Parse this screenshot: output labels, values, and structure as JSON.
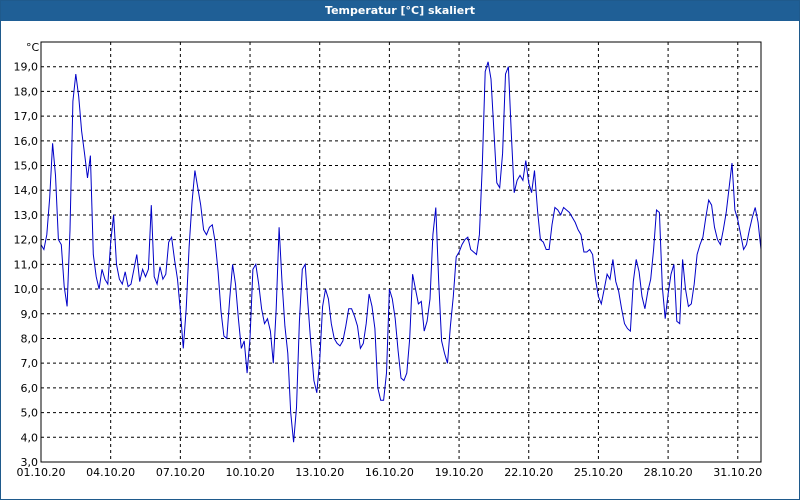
{
  "window": {
    "title": "Temperatur [°C] skaliert"
  },
  "chart_data": {
    "type": "line",
    "title": "Temperatur [°C] skaliert",
    "ylabel": "°C",
    "xlabel": "",
    "ylim": [
      3.0,
      20.0
    ],
    "xlim": [
      "2020-10-01",
      "2020-11-01"
    ],
    "yticks": [
      "3,0",
      "4,0",
      "5,0",
      "6,0",
      "7,0",
      "8,0",
      "9,0",
      "10,0",
      "11,0",
      "12,0",
      "13,0",
      "14,0",
      "15,0",
      "16,0",
      "17,0",
      "18,0",
      "19,0"
    ],
    "xticks": [
      "01.10.20",
      "04.10.20",
      "07.10.20",
      "10.10.20",
      "13.10.20",
      "16.10.20",
      "19.10.20",
      "22.10.20",
      "25.10.20",
      "28.10.20",
      "31.10.20"
    ],
    "grid": true,
    "line_color": "#0000c8",
    "series": [
      {
        "x": [
          "2020-10-01 00:00",
          "2020-10-01 03:00",
          "2020-10-01 06:00",
          "2020-10-01 09:00",
          "2020-10-01 12:00",
          "2020-10-01 15:00",
          "2020-10-01 18:00",
          "2020-10-01 21:00",
          "2020-10-02 00:00",
          "2020-10-02 03:00",
          "2020-10-02 06:00",
          "2020-10-02 09:00",
          "2020-10-02 12:00",
          "2020-10-02 15:00",
          "2020-10-02 18:00",
          "2020-10-02 21:00",
          "2020-10-03 00:00",
          "2020-10-03 03:00",
          "2020-10-03 06:00",
          "2020-10-03 09:00",
          "2020-10-03 12:00",
          "2020-10-03 15:00",
          "2020-10-03 18:00",
          "2020-10-03 21:00",
          "2020-10-04 00:00",
          "2020-10-04 03:00",
          "2020-10-04 06:00",
          "2020-10-04 09:00",
          "2020-10-04 12:00",
          "2020-10-04 15:00",
          "2020-10-04 18:00",
          "2020-10-04 21:00",
          "2020-10-05 00:00",
          "2020-10-05 03:00",
          "2020-10-05 06:00",
          "2020-10-05 09:00",
          "2020-10-05 12:00",
          "2020-10-05 15:00",
          "2020-10-05 18:00",
          "2020-10-05 21:00",
          "2020-10-06 00:00",
          "2020-10-06 03:00",
          "2020-10-06 06:00",
          "2020-10-06 09:00",
          "2020-10-06 12:00",
          "2020-10-06 15:00",
          "2020-10-06 18:00",
          "2020-10-06 21:00",
          "2020-10-07 00:00",
          "2020-10-07 03:00",
          "2020-10-07 06:00",
          "2020-10-07 09:00",
          "2020-10-07 12:00",
          "2020-10-07 15:00",
          "2020-10-07 18:00",
          "2020-10-07 21:00",
          "2020-10-08 00:00",
          "2020-10-08 03:00",
          "2020-10-08 06:00",
          "2020-10-08 09:00",
          "2020-10-08 12:00",
          "2020-10-08 15:00",
          "2020-10-08 18:00",
          "2020-10-08 21:00",
          "2020-10-09 00:00",
          "2020-10-09 03:00",
          "2020-10-09 06:00",
          "2020-10-09 09:00",
          "2020-10-09 12:00",
          "2020-10-09 15:00",
          "2020-10-09 18:00",
          "2020-10-09 21:00",
          "2020-10-10 00:00",
          "2020-10-10 03:00",
          "2020-10-10 06:00",
          "2020-10-10 09:00",
          "2020-10-10 12:00",
          "2020-10-10 15:00",
          "2020-10-10 18:00",
          "2020-10-10 21:00",
          "2020-10-11 00:00",
          "2020-10-11 03:00",
          "2020-10-11 06:00",
          "2020-10-11 09:00",
          "2020-10-11 12:00",
          "2020-10-11 15:00",
          "2020-10-11 18:00",
          "2020-10-11 21:00",
          "2020-10-12 00:00",
          "2020-10-12 03:00",
          "2020-10-12 06:00",
          "2020-10-12 09:00",
          "2020-10-12 12:00",
          "2020-10-12 15:00",
          "2020-10-12 18:00",
          "2020-10-12 21:00",
          "2020-10-13 00:00",
          "2020-10-13 03:00",
          "2020-10-13 06:00",
          "2020-10-13 09:00",
          "2020-10-13 12:00",
          "2020-10-13 15:00",
          "2020-10-13 18:00",
          "2020-10-13 21:00",
          "2020-10-14 00:00",
          "2020-10-14 03:00",
          "2020-10-14 06:00",
          "2020-10-14 09:00",
          "2020-10-14 12:00",
          "2020-10-14 15:00",
          "2020-10-14 18:00",
          "2020-10-14 21:00",
          "2020-10-15 00:00",
          "2020-10-15 03:00",
          "2020-10-15 06:00",
          "2020-10-15 09:00",
          "2020-10-15 12:00",
          "2020-10-15 15:00",
          "2020-10-15 18:00",
          "2020-10-15 21:00",
          "2020-10-16 00:00",
          "2020-10-16 03:00",
          "2020-10-16 06:00",
          "2020-10-16 09:00",
          "2020-10-16 12:00",
          "2020-10-16 15:00",
          "2020-10-16 18:00",
          "2020-10-16 21:00",
          "2020-10-17 00:00",
          "2020-10-17 03:00",
          "2020-10-17 06:00",
          "2020-10-17 09:00",
          "2020-10-17 12:00",
          "2020-10-17 15:00",
          "2020-10-17 18:00",
          "2020-10-17 21:00",
          "2020-10-18 00:00",
          "2020-10-18 03:00",
          "2020-10-18 06:00",
          "2020-10-18 09:00",
          "2020-10-18 12:00",
          "2020-10-18 15:00",
          "2020-10-18 18:00",
          "2020-10-18 21:00",
          "2020-10-19 00:00",
          "2020-10-19 03:00",
          "2020-10-19 06:00",
          "2020-10-19 09:00",
          "2020-10-19 12:00",
          "2020-10-19 15:00",
          "2020-10-19 18:00",
          "2020-10-19 21:00",
          "2020-10-20 00:00",
          "2020-10-20 03:00",
          "2020-10-20 06:00",
          "2020-10-20 09:00",
          "2020-10-20 12:00",
          "2020-10-20 15:00",
          "2020-10-20 18:00",
          "2020-10-20 21:00",
          "2020-10-21 00:00",
          "2020-10-21 03:00",
          "2020-10-21 06:00",
          "2020-10-21 09:00",
          "2020-10-21 12:00",
          "2020-10-21 15:00",
          "2020-10-21 18:00",
          "2020-10-21 21:00",
          "2020-10-22 00:00",
          "2020-10-22 03:00",
          "2020-10-22 06:00",
          "2020-10-22 09:00",
          "2020-10-22 12:00",
          "2020-10-22 15:00",
          "2020-10-22 18:00",
          "2020-10-22 21:00",
          "2020-10-23 00:00",
          "2020-10-23 03:00",
          "2020-10-23 06:00",
          "2020-10-23 09:00",
          "2020-10-23 12:00",
          "2020-10-23 15:00",
          "2020-10-23 18:00",
          "2020-10-23 21:00",
          "2020-10-24 00:00",
          "2020-10-24 03:00",
          "2020-10-24 06:00",
          "2020-10-24 09:00",
          "2020-10-24 12:00",
          "2020-10-24 15:00",
          "2020-10-24 18:00",
          "2020-10-24 21:00",
          "2020-10-25 00:00",
          "2020-10-25 03:00",
          "2020-10-25 06:00",
          "2020-10-25 09:00",
          "2020-10-25 12:00",
          "2020-10-25 15:00",
          "2020-10-25 18:00",
          "2020-10-25 21:00",
          "2020-10-26 00:00",
          "2020-10-26 03:00",
          "2020-10-26 06:00",
          "2020-10-26 09:00",
          "2020-10-26 12:00",
          "2020-10-26 15:00",
          "2020-10-26 18:00",
          "2020-10-26 21:00",
          "2020-10-27 00:00",
          "2020-10-27 03:00",
          "2020-10-27 06:00",
          "2020-10-27 09:00",
          "2020-10-27 12:00",
          "2020-10-27 15:00",
          "2020-10-27 18:00",
          "2020-10-27 21:00",
          "2020-10-28 00:00",
          "2020-10-28 03:00",
          "2020-10-28 06:00",
          "2020-10-28 09:00",
          "2020-10-28 12:00",
          "2020-10-28 15:00",
          "2020-10-28 18:00",
          "2020-10-28 21:00",
          "2020-10-29 00:00",
          "2020-10-29 03:00",
          "2020-10-29 06:00",
          "2020-10-29 09:00",
          "2020-10-29 12:00",
          "2020-10-29 15:00",
          "2020-10-29 18:00",
          "2020-10-29 21:00",
          "2020-10-30 00:00",
          "2020-10-30 03:00",
          "2020-10-30 06:00",
          "2020-10-30 09:00",
          "2020-10-30 12:00",
          "2020-10-30 15:00",
          "2020-10-30 18:00",
          "2020-10-30 21:00",
          "2020-10-31 00:00",
          "2020-10-31 03:00",
          "2020-10-31 06:00",
          "2020-10-31 09:00",
          "2020-10-31 12:00",
          "2020-10-31 15:00",
          "2020-10-31 18:00",
          "2020-10-31 21:00",
          "2020-11-01 00:00"
        ],
        "values": [
          11.8,
          11.6,
          12.2,
          13.7,
          15.9,
          14.6,
          12.0,
          11.8,
          10.1,
          9.3,
          12.4,
          17.6,
          18.7,
          17.8,
          16.4,
          15.5,
          14.5,
          15.4,
          11.4,
          10.5,
          10.0,
          10.8,
          10.4,
          10.2,
          11.9,
          13.0,
          11.0,
          10.4,
          10.2,
          10.7,
          10.1,
          10.2,
          10.8,
          11.4,
          10.3,
          10.8,
          10.5,
          10.8,
          13.4,
          10.5,
          10.2,
          10.9,
          10.4,
          10.6,
          11.9,
          12.1,
          11.2,
          10.4,
          9.1,
          7.6,
          9.2,
          11.7,
          13.5,
          14.8,
          14.1,
          13.4,
          12.4,
          12.2,
          12.5,
          12.6,
          11.9,
          10.7,
          9.1,
          8.1,
          8.0,
          9.6,
          11.0,
          10.2,
          8.8,
          7.6,
          7.9,
          6.6,
          8.0,
          10.8,
          11.0,
          10.2,
          9.2,
          8.6,
          8.8,
          8.3,
          7.0,
          9.2,
          12.5,
          10.3,
          8.5,
          7.4,
          5.0,
          3.8,
          5.2,
          8.7,
          10.8,
          11.0,
          9.3,
          7.7,
          6.3,
          5.8,
          7.1,
          9.3,
          10.0,
          9.6,
          8.6,
          8.0,
          7.8,
          7.7,
          7.9,
          8.5,
          9.2,
          9.2,
          8.9,
          8.5,
          7.6,
          7.8,
          8.6,
          9.8,
          9.3,
          8.4,
          6.0,
          5.5,
          5.5,
          6.6,
          10.0,
          9.6,
          8.8,
          7.5,
          6.4,
          6.3,
          6.6,
          8.0,
          10.6,
          10.0,
          9.4,
          9.5,
          8.3,
          8.7,
          9.6,
          12.2,
          13.3,
          10.3,
          7.9,
          7.4,
          7.0,
          8.5,
          9.7,
          11.3,
          11.5,
          11.8,
          12.0,
          12.1,
          11.6,
          11.5,
          11.4,
          12.2,
          15.0,
          18.8,
          19.2,
          18.5,
          16.4,
          14.3,
          14.1,
          15.5,
          18.7,
          19.0,
          16.3,
          13.9,
          14.4,
          14.6,
          14.4,
          15.2,
          14.3,
          13.9,
          14.8,
          13.2,
          12.0,
          11.9,
          11.6,
          11.6,
          12.6,
          13.3,
          13.2,
          13.0,
          13.3,
          13.2,
          13.1,
          12.9,
          12.7,
          12.4,
          12.2,
          11.5,
          11.5,
          11.6,
          11.4,
          10.4,
          9.7,
          9.4,
          10.0,
          10.6,
          10.4,
          11.2,
          10.3,
          9.9,
          9.2,
          8.6,
          8.4,
          8.3,
          10.3,
          11.2,
          10.7,
          9.7,
          9.2,
          9.9,
          10.4,
          11.6,
          13.2,
          13.1,
          10.1,
          8.8,
          9.8,
          10.6,
          11.0,
          8.7,
          8.6,
          11.2,
          10.0,
          9.3,
          9.4,
          10.2,
          11.4,
          11.8,
          12.1,
          12.9,
          13.6,
          13.4,
          12.5,
          12.0,
          11.8,
          12.4,
          13.1,
          14.1,
          15.1,
          13.2,
          12.8,
          12.2,
          11.6,
          11.8,
          12.4,
          12.9,
          13.3,
          12.7,
          11.6
        ]
      }
    ]
  }
}
